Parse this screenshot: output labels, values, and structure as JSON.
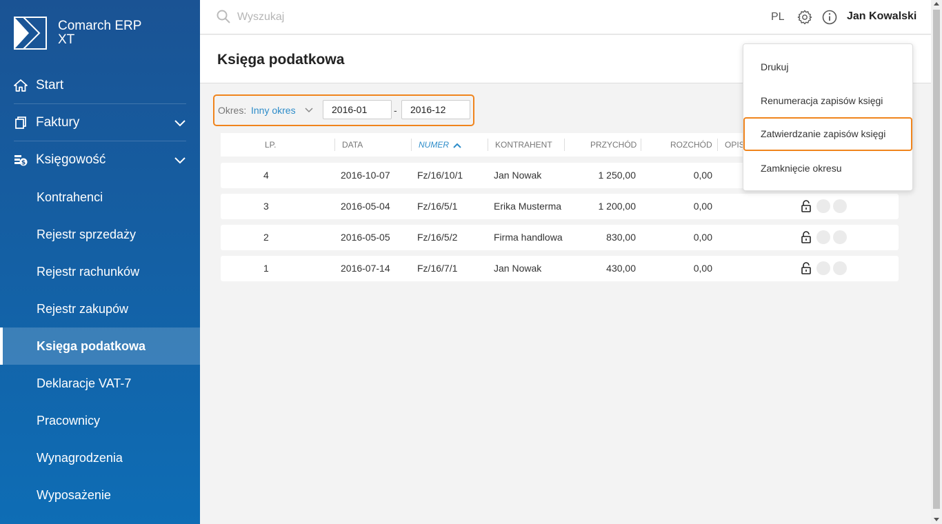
{
  "app": {
    "name_line1": "Comarch ERP",
    "name_line2": "XT"
  },
  "sidebar": {
    "top_items": [
      {
        "label": "Start",
        "icon": "home-icon"
      },
      {
        "label": "Faktury",
        "icon": "document-icon"
      },
      {
        "label": "Księgowość",
        "icon": "accounting-icon"
      }
    ],
    "sub_items": [
      {
        "label": "Kontrahenci"
      },
      {
        "label": "Rejestr sprzedaży"
      },
      {
        "label": "Rejestr rachunków"
      },
      {
        "label": "Rejestr zakupów"
      },
      {
        "label": "Księga podatkowa",
        "active": true
      },
      {
        "label": "Deklaracje VAT-7"
      },
      {
        "label": "Pracownicy"
      },
      {
        "label": "Wynagrodzenia"
      },
      {
        "label": "Wyposażenie"
      }
    ]
  },
  "header": {
    "search_placeholder": "Wyszukaj",
    "language": "PL",
    "user_name": "Jan Kowalski"
  },
  "page": {
    "title": "Księga podatkowa"
  },
  "filter": {
    "label": "Okres:",
    "period_value": "Inny okres",
    "date_from": "2016-01",
    "date_separator": "-",
    "date_to": "2016-12"
  },
  "table": {
    "columns": [
      "LP.",
      "DATA",
      "NUMER",
      "KONTRAHENT",
      "PRZYCHÓD",
      "ROZCHÓD",
      "OPIS"
    ],
    "sorted_column": "NUMER",
    "rows": [
      {
        "lp": "4",
        "data": "2016-10-07",
        "numer": "Fz/16/10/1",
        "kontrahent": "Jan Nowak",
        "przychod": "1 250,00",
        "rozchod": "0,00"
      },
      {
        "lp": "3",
        "data": "2016-05-04",
        "numer": "Fz/16/5/1",
        "kontrahent": "Erika Musterma",
        "przychod": "1 200,00",
        "rozchod": "0,00"
      },
      {
        "lp": "2",
        "data": "2016-05-05",
        "numer": "Fz/16/5/2",
        "kontrahent": "Firma handlowa",
        "przychod": "830,00",
        "rozchod": "0,00"
      },
      {
        "lp": "1",
        "data": "2016-07-14",
        "numer": "Fz/16/7/1",
        "kontrahent": "Jan Nowak",
        "przychod": "430,00",
        "rozchod": "0,00"
      }
    ]
  },
  "menu": {
    "items": [
      {
        "label": "Drukuj"
      },
      {
        "label": "Renumeracja zapisów księgi"
      },
      {
        "label": "Zatwierdzanie zapisów księgi",
        "highlighted": true
      },
      {
        "label": "Zamknięcie okresu"
      }
    ]
  },
  "colors": {
    "sidebar_top": "#1a5394",
    "sidebar_bottom": "#0e6db5",
    "accent_blue": "#2d8cc9",
    "highlight_orange": "#f0841c"
  }
}
